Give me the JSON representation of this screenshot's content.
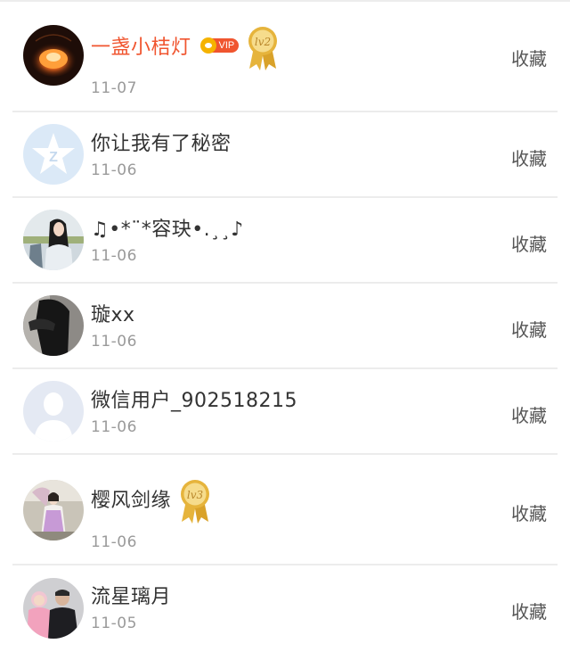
{
  "action_label": "收藏",
  "colors": {
    "vip_name": "#f0552f",
    "name": "#333333",
    "date": "#9a9a9a",
    "action": "#555555",
    "divider": "#ececec",
    "medal_gold": "#e6b43c"
  },
  "items": [
    {
      "username": "一盏小桔灯",
      "date": "11-07",
      "vip": true,
      "vip_label": "VIP",
      "level": "lv2",
      "avatar": "lantern-photo"
    },
    {
      "username": "你让我有了秘密",
      "date": "11-06",
      "vip": false,
      "level": null,
      "avatar": "qzone-star-default"
    },
    {
      "username": "♫•*¨*容玦•.¸¸♪",
      "date": "11-06",
      "vip": false,
      "level": null,
      "avatar": "girl-photo"
    },
    {
      "username": "璇xx",
      "date": "11-06",
      "vip": false,
      "level": null,
      "avatar": "dark-hair-photo"
    },
    {
      "username": "微信用户_902518215",
      "date": "11-06",
      "vip": false,
      "level": null,
      "avatar": "default-person-silhouette"
    },
    {
      "username": "樱风剑缘",
      "date": "11-06",
      "vip": false,
      "level": "lv3",
      "avatar": "costume-photo"
    },
    {
      "username": "流星璃月",
      "date": "11-05",
      "vip": false,
      "level": null,
      "avatar": "family-photo"
    }
  ]
}
